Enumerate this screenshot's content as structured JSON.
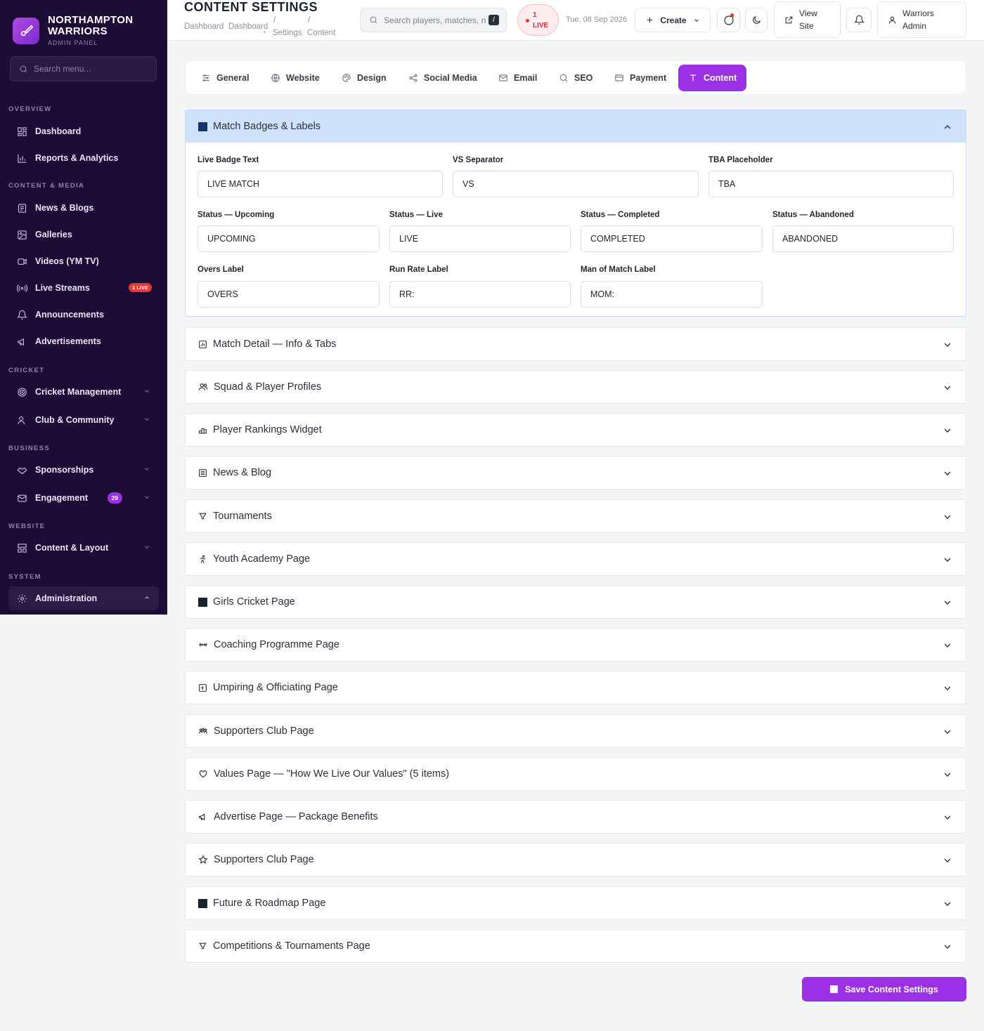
{
  "brand": {
    "name_line1": "NORTHAMPTON",
    "name_line2": "WARRIORS",
    "subtitle": "ADMIN PANEL"
  },
  "sidebar": {
    "search_placeholder": "Search menu...",
    "sections": {
      "overview": "OVERVIEW",
      "content_media": "CONTENT & MEDIA",
      "cricket": "CRICKET",
      "business": "BUSINESS",
      "website": "WEBSITE",
      "system": "SYSTEM"
    },
    "items": {
      "dashboard": "Dashboard",
      "reports": "Reports & Analytics",
      "news": "News & Blogs",
      "galleries": "Galleries",
      "videos": "Videos (YM TV)",
      "live_streams": "Live Streams",
      "live_badge": "1 LIVE",
      "announcements": "Announcements",
      "advertisements": "Advertisements",
      "cricket_management": "Cricket Management",
      "club_community": "Club & Community",
      "sponsorships": "Sponsorships",
      "engagement": "Engagement",
      "engagement_count": "29",
      "content_layout": "Content & Layout",
      "administration": "Administration"
    }
  },
  "topbar": {
    "title": "CONTENT SETTINGS",
    "breadcrumbs": {
      "c1": "Dashboard",
      "c2": "Dashboard",
      "sep1": "/",
      "sep2": "/",
      "c3": "Settings",
      "c4": "Content"
    },
    "search_placeholder": "Search players, matches, n",
    "search_kbd": "/",
    "live_count": "1",
    "live_label": "LIVE",
    "date": "Tue, 08 Sep 2026",
    "create_label": "Create",
    "view_site_l1": "View",
    "view_site_l2": "Site",
    "user_l1": "Warriors",
    "user_l2": "Admin"
  },
  "tabs": [
    {
      "label": "General",
      "icon": "sliders-icon"
    },
    {
      "label": "Website",
      "icon": "globe-icon"
    },
    {
      "label": "Design",
      "icon": "palette-icon"
    },
    {
      "label": "Social Media",
      "icon": "share-icon"
    },
    {
      "label": "Email",
      "icon": "mail-icon"
    },
    {
      "label": "SEO",
      "icon": "search-icon"
    },
    {
      "label": "Payment",
      "icon": "card-icon"
    },
    {
      "label": "Content",
      "icon": "text-icon",
      "active": true
    }
  ],
  "open_section": {
    "title": "Match Badges & Labels",
    "fields": {
      "live_badge": {
        "label": "Live Badge Text",
        "value": "LIVE MATCH"
      },
      "vs_separator": {
        "label": "VS Separator",
        "value": "VS"
      },
      "tba": {
        "label": "TBA Placeholder",
        "value": "TBA"
      },
      "status_upcoming": {
        "label": "Status — Upcoming",
        "value": "UPCOMING"
      },
      "status_live": {
        "label": "Status — Live",
        "value": "LIVE"
      },
      "status_completed": {
        "label": "Status — Completed",
        "value": "COMPLETED"
      },
      "status_abandoned": {
        "label": "Status — Abandoned",
        "value": "ABANDONED"
      },
      "overs": {
        "label": "Overs Label",
        "value": "OVERS"
      },
      "run_rate": {
        "label": "Run Rate Label",
        "value": "RR:"
      },
      "mom": {
        "label": "Man of Match Label",
        "value": "MOM:"
      }
    }
  },
  "sections": [
    {
      "title": "Match Detail — Info & Tabs",
      "icon": "chart-box-icon"
    },
    {
      "title": "Squad & Player Profiles",
      "icon": "users-icon"
    },
    {
      "title": "Player Rankings Widget",
      "icon": "podium-icon"
    },
    {
      "title": "News & Blog",
      "icon": "newspaper-icon"
    },
    {
      "title": "Tournaments",
      "icon": "trophy-icon"
    },
    {
      "title": "Youth Academy Page",
      "icon": "runner-icon"
    },
    {
      "title": "Girls Cricket Page",
      "icon": "square-icon"
    },
    {
      "title": "Coaching Programme Page",
      "icon": "dumbbell-icon"
    },
    {
      "title": "Umpiring & Officiating Page",
      "icon": "scoreboard-icon"
    },
    {
      "title": "Supporters Club Page",
      "icon": "crowd-icon"
    },
    {
      "title": "Values Page — \"How We Live Our Values\" (5 items)",
      "icon": "heart-icon"
    },
    {
      "title": "Advertise Page — Package Benefits",
      "icon": "megaphone-icon"
    },
    {
      "title": "Supporters Club Page",
      "icon": "star-icon"
    },
    {
      "title": "Future & Roadmap Page",
      "icon": "square-icon"
    },
    {
      "title": "Competitions & Tournaments Page",
      "icon": "trophy-icon"
    }
  ],
  "save_label": "Save Content Settings",
  "colors": {
    "sidebar": "#1c0c36",
    "accent": "#9b30e6",
    "open_header": "#cfe2fb",
    "live_red": "#e53935"
  }
}
